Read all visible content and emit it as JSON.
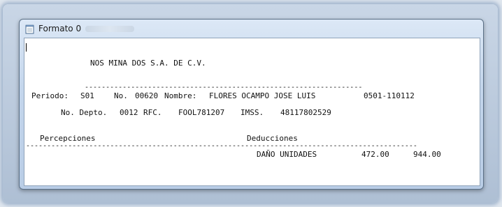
{
  "window": {
    "title": "Formato 0"
  },
  "report": {
    "company": "NOS MINA DOS S.A. DE C.V.",
    "separator_top": "------------------------------------------------------------------",
    "periodo_label": "Periodo:",
    "periodo_value": "S01",
    "no_label": "No.",
    "no_value": "00620",
    "nombre_label": "Nombre:",
    "nombre_value": "FLORES OCAMPO JOSE LUIS",
    "range_value": "0501-110112",
    "depto_label": "No. Depto.",
    "depto_value": "0012",
    "rfc_label": "RFC.",
    "rfc_value": "FOOL781207",
    "imss_label": "IMSS.",
    "imss_value": "48117802529",
    "percepciones_label": "Percepciones",
    "deducciones_label": "Deducciones",
    "separator_mid": "---------------------------------------------------------------------------------------------",
    "deduccion_item": "DAÑO UNIDADES",
    "deduccion_amount": "472.00",
    "deduccion_total": "944.00"
  }
}
